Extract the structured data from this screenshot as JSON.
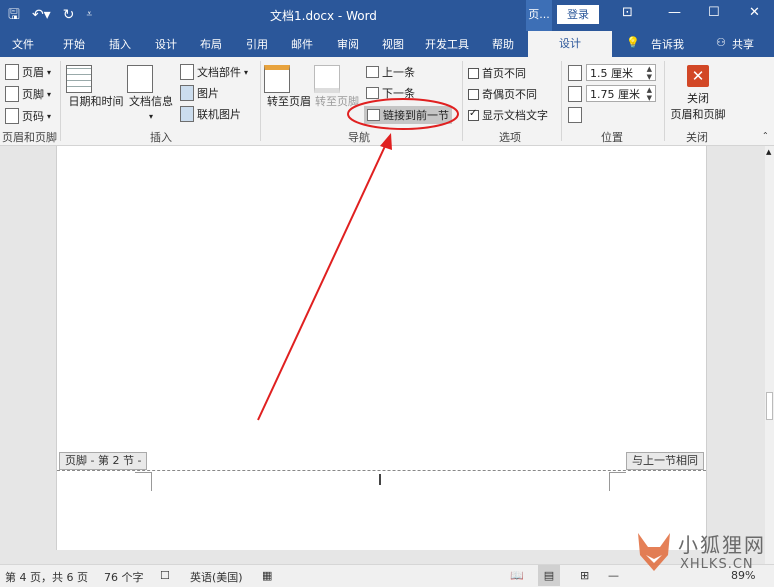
{
  "window": {
    "title": "文档1.docx - Word",
    "context_label": "页...",
    "login_label": "登录",
    "qat_icons": [
      "save-icon",
      "undo-icon",
      "redo-icon",
      "customize-icon"
    ],
    "buttons": [
      "ribbon-display-icon",
      "minimize-icon",
      "maximize-icon",
      "close-icon"
    ]
  },
  "tabs": {
    "items": [
      "文件",
      "开始",
      "插入",
      "设计",
      "布局",
      "引用",
      "邮件",
      "审阅",
      "视图",
      "开发工具",
      "帮助",
      "设计"
    ],
    "tell_me": "告诉我",
    "share": "共享"
  },
  "ribbon": {
    "header_footer_group": {
      "header": "页眉",
      "footer": "页脚",
      "page_number": "页码",
      "label": "页眉和页脚"
    },
    "insert_group": {
      "date_time": "日期和时间",
      "doc_info": "文档信息",
      "doc_parts": "文档部件",
      "picture": "图片",
      "online_picture": "联机图片",
      "label": "插入"
    },
    "navigation_group": {
      "goto_header": "转至页眉",
      "goto_footer": "转至页脚",
      "previous": "上一条",
      "next": "下一条",
      "link_previous": "链接到前一节",
      "label": "导航"
    },
    "options_group": {
      "different_first": "首页不同",
      "different_odd_even": "奇偶页不同",
      "show_doc_text": "显示文档文字",
      "label": "选项"
    },
    "position_group": {
      "header_from_top": "1.5 厘米",
      "footer_from_bottom": "1.75 厘米",
      "label": "位置"
    },
    "close_group": {
      "close_label_1": "关闭",
      "close_label_2": "页眉和页脚",
      "label": "关闭"
    }
  },
  "document": {
    "footer_tag": "页脚 - 第 2 节 -",
    "same_as_previous": "与上一节相同"
  },
  "statusbar": {
    "page_info": "第 4 页，共 6 页",
    "word_count": "76 个字",
    "language": "英语(美国)",
    "zoom": "89%"
  },
  "watermark": {
    "cn": "小狐狸网",
    "en": "XHLKS.CN"
  },
  "colors": {
    "word_blue": "#2b579a",
    "annotation_red": "#e02020",
    "close_red": "#d24726"
  }
}
